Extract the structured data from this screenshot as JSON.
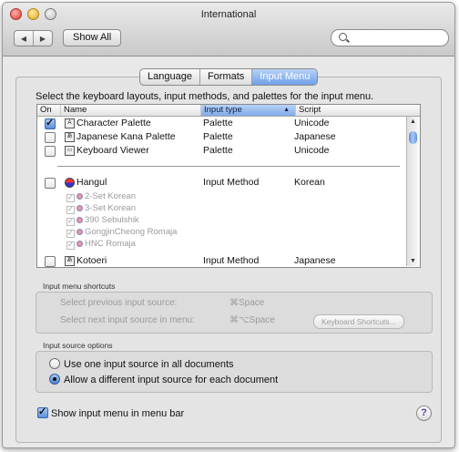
{
  "window": {
    "title": "International"
  },
  "toolbar": {
    "back": "◀",
    "forward": "▶",
    "show_all": "Show All",
    "search_placeholder": ""
  },
  "tabs": [
    {
      "label": "Language"
    },
    {
      "label": "Formats"
    },
    {
      "label": "Input Menu"
    }
  ],
  "description": "Select the keyboard layouts, input methods, and palettes for the input menu.",
  "table": {
    "headers": {
      "on": "On",
      "name": "Name",
      "type": "Input type",
      "script": "Script",
      "sort": "▲"
    },
    "rows": [
      {
        "name": "Character Palette",
        "type": "Palette",
        "script": "Unicode",
        "on": true
      },
      {
        "name": "Japanese Kana Palette",
        "type": "Palette",
        "script": "Japanese",
        "on": false
      },
      {
        "name": "Keyboard Viewer",
        "type": "Palette",
        "script": "Unicode",
        "on": false
      },
      {
        "name": "Hangul",
        "type": "Input Method",
        "script": "Korean",
        "on": false
      },
      {
        "name": "Kotoeri",
        "type": "Input Method",
        "script": "Japanese",
        "on": false
      }
    ],
    "hangul_subitems": [
      "2-Set Korean",
      "3-Set Korean",
      "390 Sebulshik",
      "GongjinCheong Romaja",
      "HNC Romaja"
    ]
  },
  "shortcuts": {
    "label": "Input menu shortcuts",
    "prev_label": "Select previous input source:",
    "prev_key": "⌘Space",
    "next_label": "Select next input source in menu:",
    "next_key": "⌘⌥Space",
    "button": "Keyboard Shortcuts..."
  },
  "options": {
    "label": "Input source options",
    "opt1": "Use one input source in all documents",
    "opt2": "Allow a different input source for each document",
    "selected": "opt2"
  },
  "show_menu": "Show input menu in menu bar",
  "help": "?"
}
